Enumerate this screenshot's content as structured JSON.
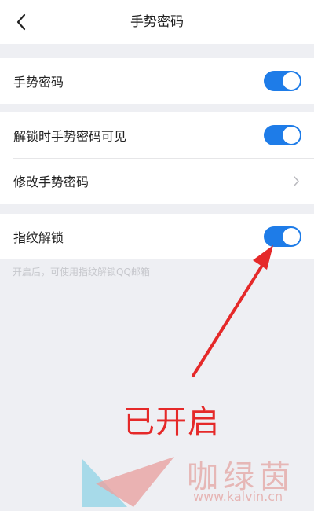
{
  "header": {
    "title": "手势密码"
  },
  "groups": [
    {
      "rows": [
        {
          "label": "手势密码",
          "toggle_on": true
        }
      ]
    },
    {
      "rows": [
        {
          "label": "解锁时手势密码可见",
          "toggle_on": true
        },
        {
          "label": "修改手势密码"
        }
      ]
    },
    {
      "rows": [
        {
          "label": "指纹解锁",
          "toggle_on": true
        }
      ]
    }
  ],
  "fingerprint_hint": "开启后，可使用指纹解锁QQ邮箱",
  "annotation_text": "已开启",
  "watermark": {
    "cn": "咖绿茵",
    "url": "www.kalvin.cn"
  },
  "icons": [
    "chevron-left-icon",
    "chevron-right-icon",
    "red-arrow-icon",
    "watermark-logo-icon"
  ],
  "colors": {
    "toggle_on": "#1e7ce8",
    "annotation": "#e52929",
    "background": "#eeeff3"
  }
}
